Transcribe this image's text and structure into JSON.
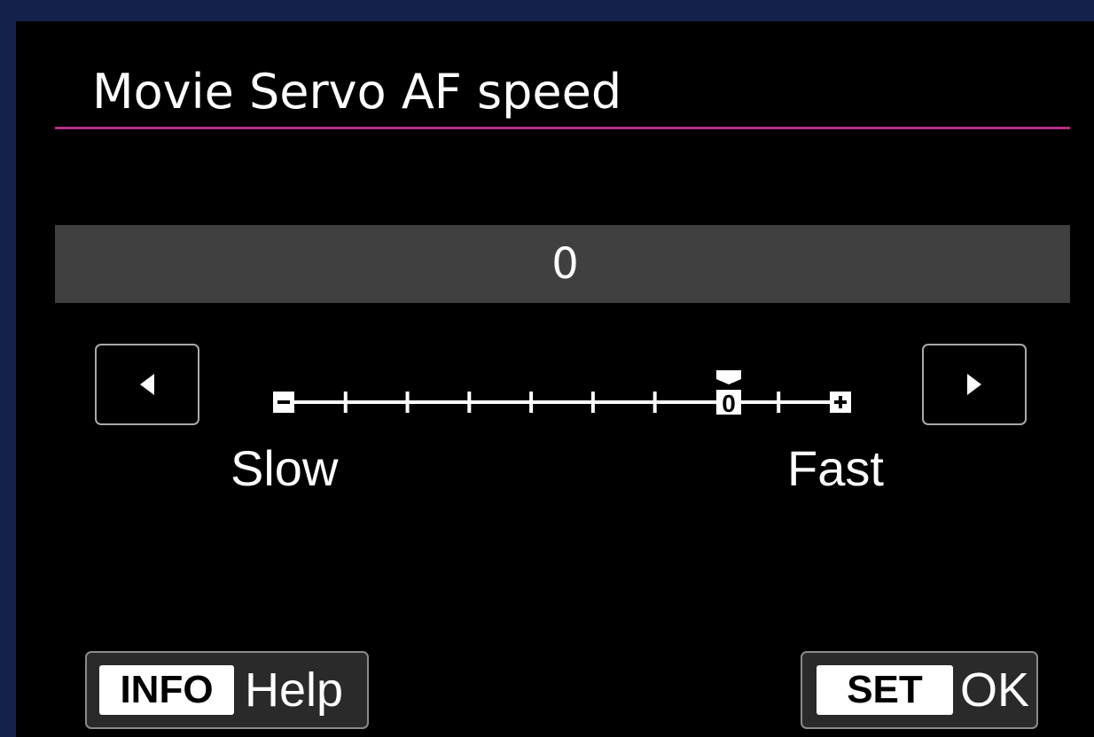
{
  "title": "Movie Servo AF speed",
  "current_value": "0",
  "slider": {
    "min_label": "Slow",
    "max_label": "Fast",
    "steps": [
      "-",
      "",
      "",
      "",
      "",
      "",
      "",
      "0",
      "",
      "+"
    ],
    "center_label": "0",
    "selected_index": 7
  },
  "buttons": {
    "help_key": "INFO",
    "help_label": "Help",
    "ok_key": "SET",
    "ok_label": "OK"
  },
  "icons": {
    "left": "triangle-left-icon",
    "right": "triangle-right-icon",
    "indicator": "triangle-down-icon"
  },
  "colors": {
    "accent": "#b52d86",
    "value_bar": "#404040",
    "background": "#000000",
    "frame": "#14214a"
  }
}
